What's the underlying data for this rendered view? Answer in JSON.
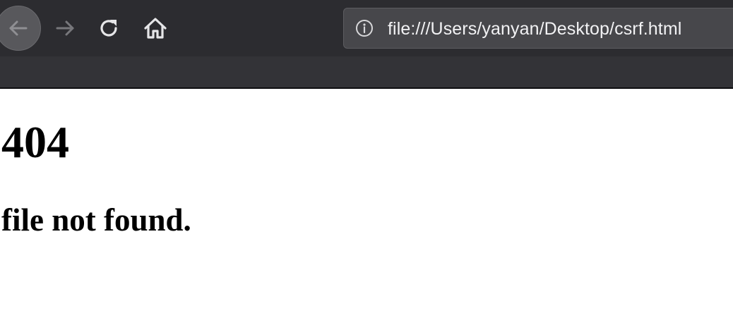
{
  "toolbar": {
    "back_icon": "arrow-left-icon",
    "forward_icon": "arrow-right-icon",
    "reload_icon": "reload-icon",
    "home_icon": "home-icon"
  },
  "address_bar": {
    "info_icon": "info-icon",
    "url": "file:///Users/yanyan/Desktop/csrf.html"
  },
  "page": {
    "heading": "404",
    "message": "file not found."
  },
  "colors": {
    "chrome_background": "#2c2c30",
    "url_bar_background": "#47474b",
    "page_background": "#ffffff",
    "text": "#000000"
  }
}
